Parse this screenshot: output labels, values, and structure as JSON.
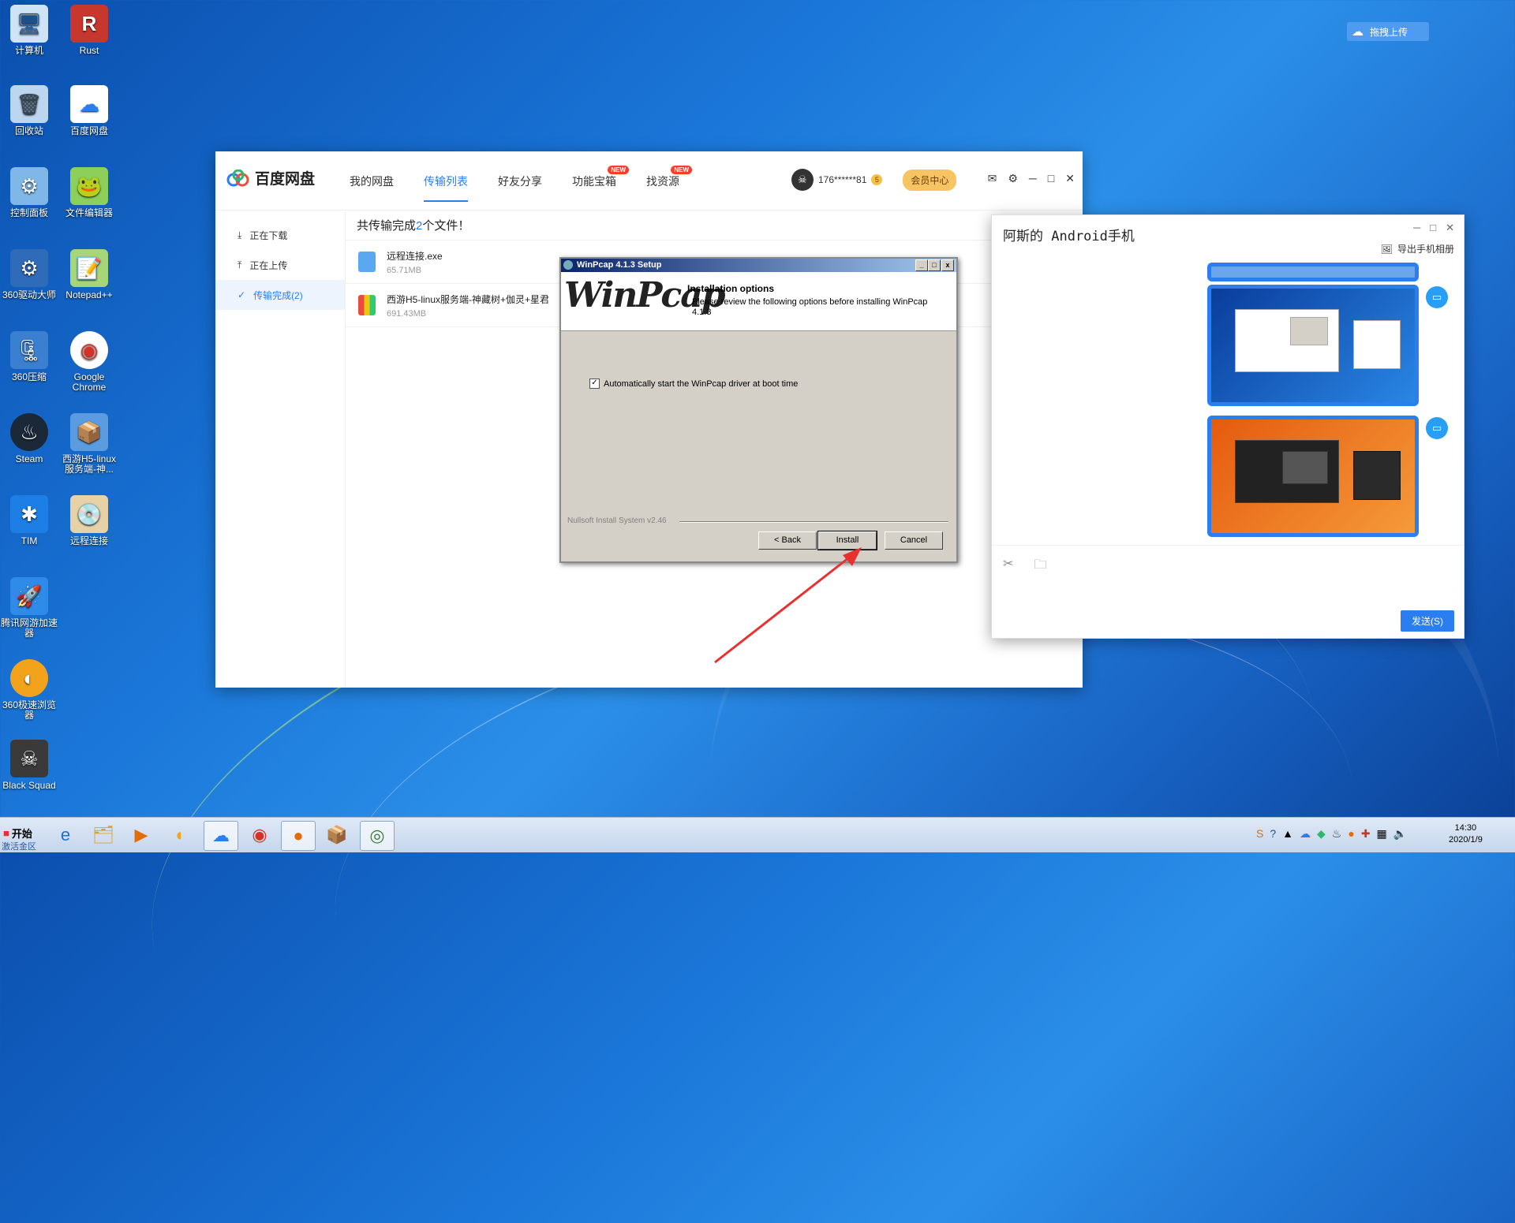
{
  "desktop": {
    "icons": [
      {
        "label": "计算机",
        "glyph": "🖥"
      },
      {
        "label": "Rust",
        "glyph": "R"
      },
      {
        "label": "回收站",
        "glyph": "🗑"
      },
      {
        "label": "百度网盘",
        "glyph": "☁"
      },
      {
        "label": "控制面板",
        "glyph": "⚙"
      },
      {
        "label": "文件编辑器",
        "glyph": "🐸"
      },
      {
        "label": "360驱动大师",
        "glyph": "⚙"
      },
      {
        "label": "Notepad++",
        "glyph": "📝"
      },
      {
        "label": "360压缩",
        "glyph": "🗜"
      },
      {
        "label": "Google Chrome",
        "glyph": "◉"
      },
      {
        "label": "Steam",
        "glyph": "♨"
      },
      {
        "label": "西游H5-linux服务端-神...",
        "glyph": "📦"
      },
      {
        "label": "TIM",
        "glyph": "✱"
      },
      {
        "label": "远程连接",
        "glyph": "💿"
      },
      {
        "label": "腾讯网游加速器",
        "glyph": "🚀"
      },
      {
        "label": "360极速浏览器",
        "glyph": "◐"
      },
      {
        "label": "Black Squad",
        "glyph": "☠"
      }
    ],
    "drag_upload": "拖拽上传"
  },
  "baidu": {
    "app_name": "百度网盘",
    "nav": [
      {
        "label": "我的网盘",
        "badge": ""
      },
      {
        "label": "传输列表",
        "badge": ""
      },
      {
        "label": "好友分享",
        "badge": ""
      },
      {
        "label": "功能宝箱",
        "badge": "NEW"
      },
      {
        "label": "找资源",
        "badge": "NEW"
      }
    ],
    "user": {
      "name": "176******81",
      "coin": "5",
      "vip": "会员中心"
    },
    "sidebar": [
      {
        "label": "正在下载"
      },
      {
        "label": "正在上传"
      },
      {
        "label": "传输完成(2)"
      }
    ],
    "summary": {
      "prefix": "共传输完成",
      "count": "2",
      "suffix": "个文件！"
    },
    "files": [
      {
        "name": "远程连接.exe",
        "size": "65.71MB"
      },
      {
        "name": "西游H5-linux服务端-神藏树+伽灵+星君",
        "size": "691.43MB"
      }
    ]
  },
  "winpcap": {
    "title": "WinPcap 4.1.3 Setup",
    "logo": "WinPcap",
    "heading": "Installation options",
    "subheading": "Please review the following options before installing WinPcap 4.1.3",
    "option_label": "Automatically start the WinPcap driver at boot time",
    "option_checked": true,
    "nsis": "Nullsoft Install System v2.46",
    "buttons": {
      "back": "< Back",
      "install": "Install",
      "cancel": "Cancel"
    }
  },
  "phone": {
    "title": "阿斯的 Android手机",
    "export": "导出手机相册",
    "send": "发送(S)"
  },
  "taskbar": {
    "start": "开始",
    "start_sub": "激活金区",
    "clock_time": "14:30",
    "clock_date": "2020/1/9"
  },
  "colors": {
    "accent": "#2a7ef0",
    "annotation_arrow": "#e8312f"
  }
}
